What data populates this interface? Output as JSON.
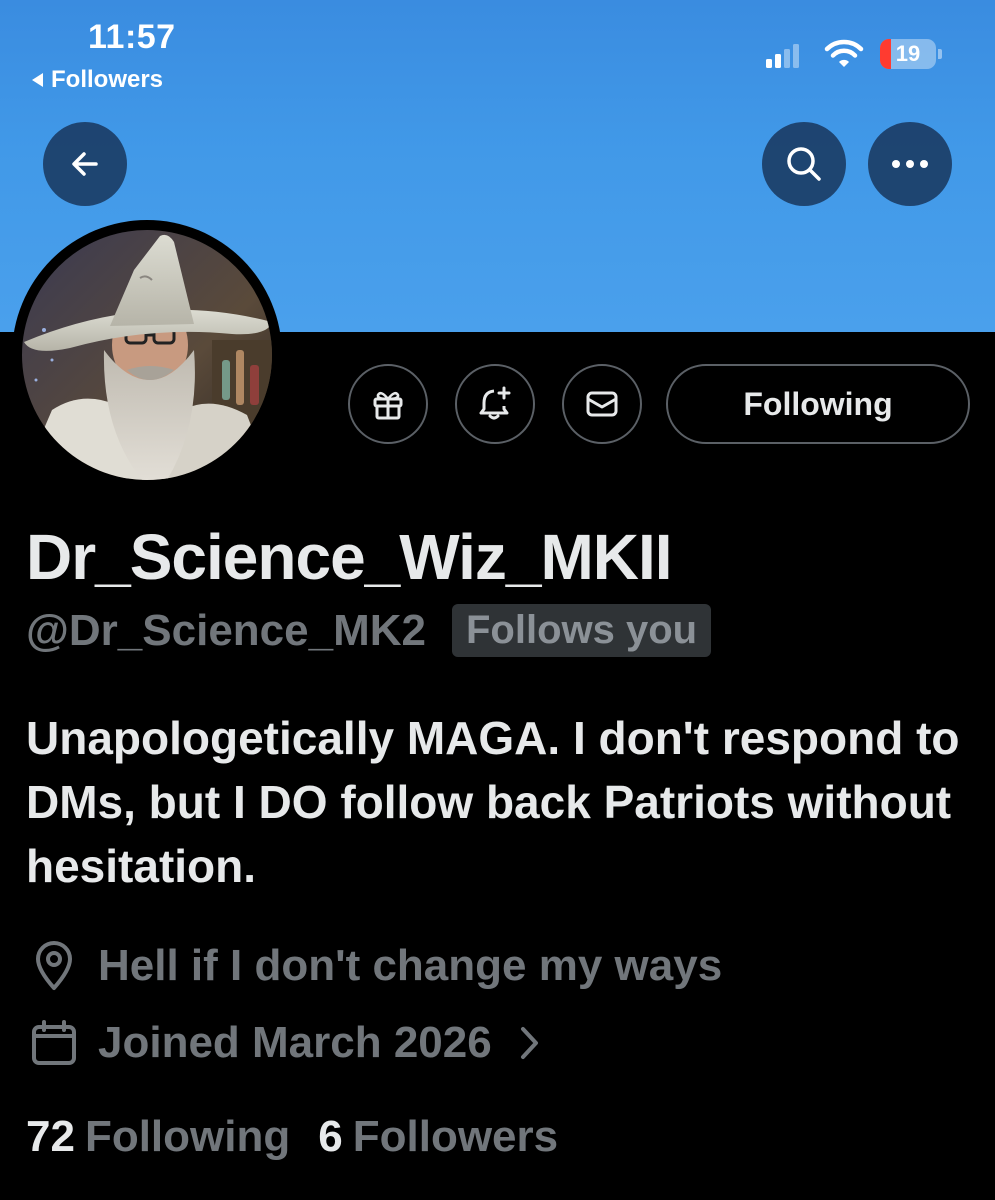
{
  "status_bar": {
    "time": "11:57",
    "back_app": "Followers",
    "battery_level": "19"
  },
  "header": {
    "icons": {
      "back": "arrow-left-icon",
      "search": "search-icon",
      "more": "more-horizontal-icon"
    },
    "banner_color": "#4199e8"
  },
  "profile": {
    "display_name": "Dr_Science_Wiz_MKII",
    "handle": "@Dr_Science_MK2",
    "follows_you_badge": "Follows you",
    "bio": "Unapologetically MAGA. I don't respond to DMs, but I DO follow back Patriots without hesitation.",
    "location": "Hell if I don't change my ways",
    "joined": "Joined March 2026",
    "following_count": "72",
    "following_label": "Following",
    "followers_count": "6",
    "followers_label": "Followers"
  },
  "actions": {
    "icons": [
      "gift-icon",
      "bell-plus-icon",
      "mail-icon"
    ],
    "following_button": "Following"
  }
}
